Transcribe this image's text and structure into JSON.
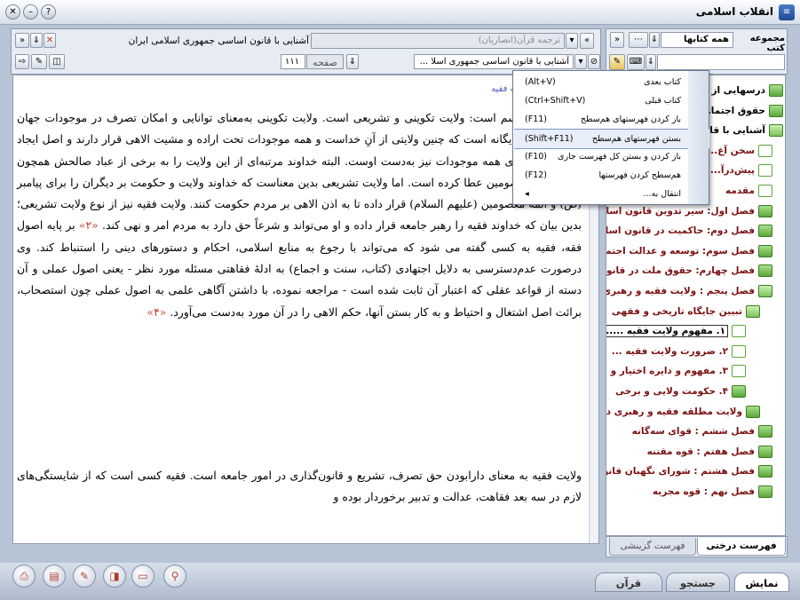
{
  "app": {
    "title": "انقلاب اسلامی",
    "icon_text": "≡"
  },
  "left_panel": {
    "book_title": "آشنایی با قانون اساسی جمهوری اسلامی ایران",
    "translation_field": "ترجمه قرآن(انصاریان)",
    "doc_selector": "آشنایی با قانون اساسی جمهوری اسلا ...",
    "page_label": "صفحه",
    "page_number": "۱۱۱",
    "heading_fragment": "ت فقیه",
    "paragraphs": [
      "ولایت  بر دو قسم است: ولایت تکوینی و تشریعی است. ولایت تکوینی به‌معنای توانایی و امکان تصرف در موجودات جهان است و خداوند یگانه است که چنین ولایتی از آنِ خداست و همه موجودات تحت اراده و مشیت الاهی قرار دارند و اصل ایجاد موجودات و بقای همه موجودات نیز به‌دست اوست. البته خداوند مرتبه‌ای از این ولایت را به برخی از عباد صالحش همچون انبیا و ائمه معصومین عطا کرده است. اما ولایت تشریعی بدین معناست که خداوند ولایت و حکومت بر دیگران را برای پیامبر (ص) و ائمه معصومین (علیهم السلام) قرار داده تا به اذن الاهی بر مردم حکومت کنند. ولایت فقیه نیز از نوع ولایت تشریعی؛ بدین بیان که خداوند فقیه را رهبر جامعه قرار داده و او می‌تواند و شرعاً حق دارد به مردم امر و نهی کند.",
      "ولایت فقیه به معنای دارابودن حق تصرف، تشریع و قانون‌گذاری در امور جامعه است. فقیه کسی است که از شایستگی‌های لازم در سه بعد فقاهت، عدالت و تدبیر برخوردار بوده و"
    ],
    "paragraph1_tail": "بر پایه اصول فقه، فقیه به کسی گفته می شود که می‌تواند با رجوع به منابع اسلامی، احکام و دستورهای دینی را استنباط کند. وی درصورت عدم‌دسترسی به دلایل اجتهادی (کتاب، سنت و اجماع) به ادلهٔ فقاهتی مسئله مورد نظر - یعنی اصول عملی و آن دسته از قواعد عقلی که اعتبار آن ثابت شده است - مراجعه نموده، با داشتن آگاهی علمی به اصول عملی چون استصحاب، برائت اصل اشتغال و احتیاط و به کار بستن آنها، حکم الاهی را در آن مورد به‌دست می‌آورد.",
    "footnotes": [
      "«۲»",
      "«۳»",
      "«۴»"
    ]
  },
  "right_panel": {
    "collection_label": "مجموعه کتب",
    "collection_value": "همه کتابها",
    "search_placeholder": "",
    "tree_items": [
      {
        "label": "درسهایی از ...",
        "kind": "book",
        "level": 0
      },
      {
        "label": "حقوق اجتما...",
        "kind": "book",
        "level": 0
      },
      {
        "label": "آشنایی با قا...",
        "kind": "open",
        "level": 0
      },
      {
        "label": "سخن آغ...",
        "kind": "doc",
        "level": 1
      },
      {
        "label": "پیش‌درآ...",
        "kind": "doc",
        "level": 1
      },
      {
        "label": "مقدمه",
        "kind": "doc",
        "level": 1
      },
      {
        "label": "فصل اول: سیر تدوین قانون اسا",
        "kind": "book",
        "level": 1
      },
      {
        "label": "فصل دوم: حاکمیت در قانون اسا",
        "kind": "book",
        "level": 1
      },
      {
        "label": "فصل سوم: توسعه و عدالت اجتما",
        "kind": "book",
        "level": 1
      },
      {
        "label": "فصل چهارم: حقوق ملت در قانون",
        "kind": "book",
        "level": 1
      },
      {
        "label": "فصل پنجم : ولایت فقیه و رهبری",
        "kind": "open",
        "level": 1
      },
      {
        "label": "تبیین جایگاه تاریخی و فقهی",
        "kind": "open",
        "level": 2
      },
      {
        "label": "۱. مفهوم ولایت فقیه .....",
        "kind": "doc",
        "level": 3,
        "selected": true
      },
      {
        "label": "۲. ضرورت ولایت فقیه ...",
        "kind": "doc",
        "level": 3
      },
      {
        "label": "۳. مفهوم و دایره اختیار و",
        "kind": "doc",
        "level": 3
      },
      {
        "label": "۴. حکومت ولایی و برخی",
        "kind": "book",
        "level": 3
      },
      {
        "label": "ولایت مطلقه فقیه و رهبری د",
        "kind": "book",
        "level": 2
      },
      {
        "label": "فصل ششم : قوای سه‌گانه",
        "kind": "book",
        "level": 1
      },
      {
        "label": "فصل هفتم : قوه مقننه",
        "kind": "book",
        "level": 1
      },
      {
        "label": "فصل هشتم : شورای نگهبان قانو",
        "kind": "book",
        "level": 1
      },
      {
        "label": "فصل نهم : قوه مجریه",
        "kind": "book",
        "level": 1
      }
    ],
    "tabs": [
      {
        "label": "فهرست درختی",
        "active": true
      },
      {
        "label": "فهرست گزینشی",
        "active": false
      }
    ]
  },
  "context_menu": {
    "items": [
      {
        "label": "کتاب بعدی",
        "shortcut": "(Alt+V)",
        "icon": "⇓"
      },
      {
        "label": "کتاب قبلی",
        "shortcut": "(Ctrl+Shift+V)",
        "icon": "⇑"
      },
      {
        "label": "باز کردن فهرستهای هم‌سطح",
        "shortcut": "(F11)",
        "icon": "≡"
      },
      {
        "label": "بستن فهرستهای هم‌سطح",
        "shortcut": "(Shift+F11)",
        "icon": "≡",
        "highlighted": true
      },
      {
        "label": "باز کردن و بستن کل فهرست جاری",
        "shortcut": "(F10)",
        "icon": "◆"
      },
      {
        "label": "هم‌سطح کردن فهرستها",
        "shortcut": "(F12)",
        "icon": "◆"
      },
      {
        "label": "انتقال به...",
        "shortcut": "",
        "icon": "",
        "submenu_arrow": "◂"
      }
    ]
  },
  "footer": {
    "nav_tabs": [
      {
        "label": "نمایش",
        "active": true
      },
      {
        "label": "جستجو",
        "active": false
      },
      {
        "label": "قرآن",
        "active": false
      }
    ]
  }
}
